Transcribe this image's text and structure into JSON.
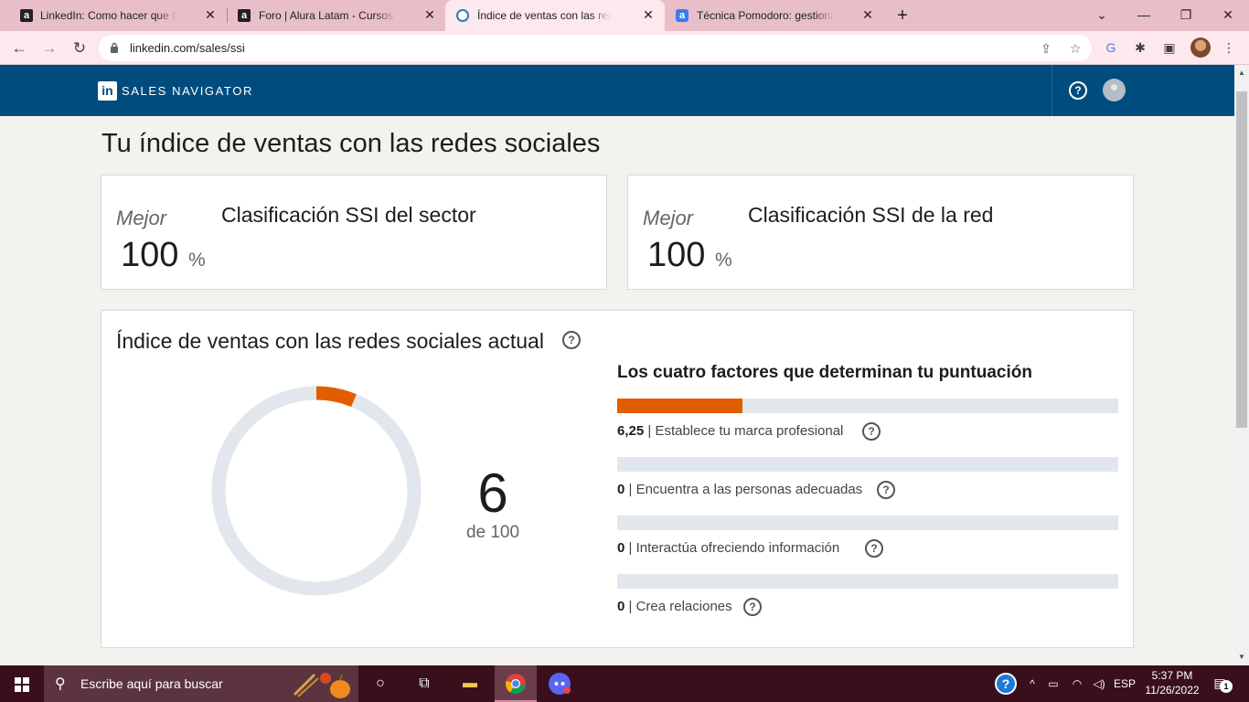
{
  "browser": {
    "tabs": [
      {
        "title": "LinkedIn: Como hacer que tu perfil",
        "favicon": "a",
        "icon": "alura-icon"
      },
      {
        "title": "Foro | Alura Latam - Cursos online",
        "favicon": "a",
        "icon": "alura-icon"
      },
      {
        "title": "Índice de ventas con las redes sociales",
        "favicon": "",
        "icon": "linkedin-sn-icon",
        "active": true
      },
      {
        "title": "Técnica Pomodoro: gestiona tu tiempo",
        "favicon": "a",
        "icon": "alura-icon"
      }
    ],
    "url": "linkedin.com/sales/ssi"
  },
  "header": {
    "logo": "in",
    "product": "SALES NAVIGATOR",
    "help": "?"
  },
  "page": {
    "title": "Tu índice de ventas con las redes sociales",
    "sector": {
      "best": "Mejor",
      "value": "100",
      "unit": "%",
      "title": "Clasificación SSI del sector"
    },
    "network": {
      "best": "Mejor",
      "value": "100",
      "unit": "%",
      "title": "Clasificación SSI de la red"
    },
    "index": {
      "title": "Índice de ventas con las redes sociales actual",
      "score": "6",
      "score_of": "de 100",
      "score_fraction": 0.0625,
      "factors_title": "Los cuatro factores que determinan tu puntuación",
      "factors": [
        {
          "value": "6,25",
          "label": "Establece tu marca profesional",
          "fraction": 0.25
        },
        {
          "value": "0",
          "label": "Encuentra a las personas adecuadas",
          "fraction": 0
        },
        {
          "value": "0",
          "label": "Interactúa ofreciendo información",
          "fraction": 0
        },
        {
          "value": "0",
          "label": "Crea relaciones",
          "fraction": 0
        }
      ],
      "colors": {
        "accent": "#e05e00",
        "track": "#e1e7ec"
      }
    }
  },
  "taskbar": {
    "search_placeholder": "Escribe aquí para buscar",
    "language": "ESP",
    "time": "5:37 PM",
    "date": "11/26/2022",
    "notifications": "1"
  }
}
